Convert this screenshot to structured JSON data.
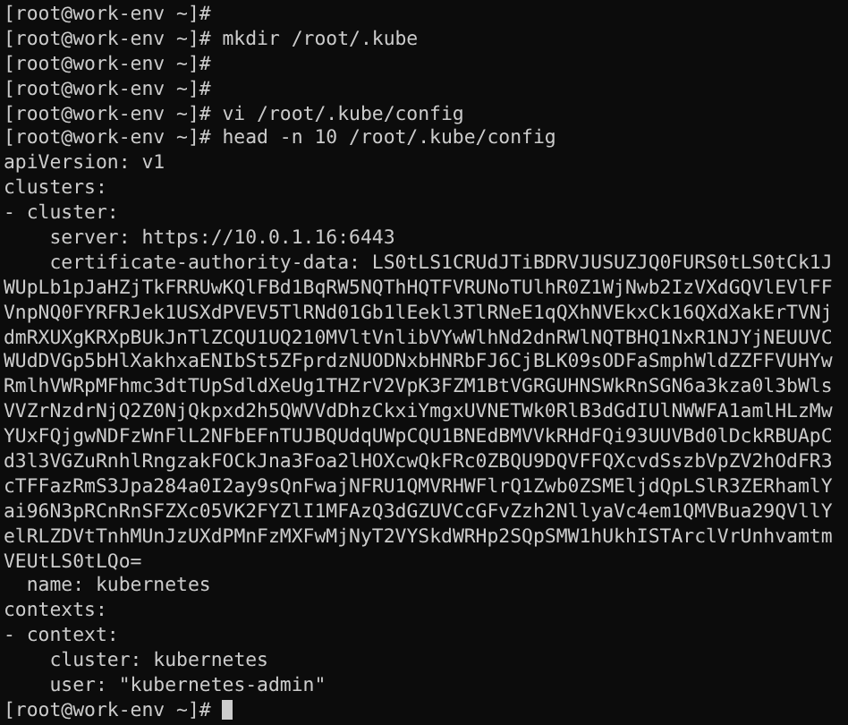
{
  "terminal": {
    "lines": [
      {
        "kind": "prompt",
        "prompt": "[root@work-env ~]#",
        "cursor": false
      },
      {
        "kind": "prompt",
        "prompt": "[root@work-env ~]#",
        "command": "mkdir /root/.kube",
        "cursor": false
      },
      {
        "kind": "prompt",
        "prompt": "[root@work-env ~]#",
        "cursor": false
      },
      {
        "kind": "prompt",
        "prompt": "[root@work-env ~]#",
        "cursor": false
      },
      {
        "kind": "prompt",
        "prompt": "[root@work-env ~]#",
        "command": "vi /root/.kube/config",
        "cursor": false
      },
      {
        "kind": "prompt",
        "prompt": "[root@work-env ~]#",
        "command": "head -n 10 /root/.kube/config",
        "cursor": false
      },
      {
        "kind": "output",
        "text": "apiVersion: v1"
      },
      {
        "kind": "output",
        "text": "clusters:"
      },
      {
        "kind": "output",
        "text": "- cluster:"
      },
      {
        "kind": "output",
        "text": "    server: https://10.0.1.16:6443"
      },
      {
        "kind": "output",
        "text": "    certificate-authority-data: LS0tLS1CRUdJTiBDRVJUSUZJQ0FURS0tLS0tCk1J"
      },
      {
        "kind": "output",
        "text": "WUpLb1pJaHZjTkFRRUwKQlFBd1BqRW5NQThHQTFVRUNoTUlhR0Z1WjNwb2IzVXdGQVlEVlFF"
      },
      {
        "kind": "output",
        "text": "VnpNQ0FYRFRJek1USXdPVEV5TlRNd01Gb1lEekl3TlRNeE1qQXhNVEkxCk16QXdXakErTVNj"
      },
      {
        "kind": "output",
        "text": "dmRXUXgKRXpBUkJnTlZCQU1UQ210MVltVnlibVYwWlhNd2dnRWlNQTBHQ1NxR1NJYjNEUUVC"
      },
      {
        "kind": "output",
        "text": "WUdDVGp5bHlXakhxaENIbSt5ZFprdzNUODNxbHNRbFJ6CjBLK09sODFaSmphWldZZFFVUHYw"
      },
      {
        "kind": "output",
        "text": "RmlhVWRpMFhmc3dtTUpSdldXeUg1THZrV2VpK3FZM1BtVGRGUHNSWkRnSGN6a3kza0l3bWls"
      },
      {
        "kind": "output",
        "text": "VVZrNzdrNjQ2Z0NjQkpxd2h5QWVVdDhzCkxiYmgxUVNETWk0RlB3dGdIUlNWWFA1amlHLzMw"
      },
      {
        "kind": "output",
        "text": "YUxFQjgwNDFzWnFlL2NFbEFnTUJBQUdqUWpCQU1BNEdBMVVkRHdFQi93UUVBd0lDckRBUApC"
      },
      {
        "kind": "output",
        "text": "d3l3VGZuRnhlRngzakFOCkJna3Foa2lHOXcwQkFRc0ZBQU9DQVFFQXcvdSszbVpZV2hOdFR3"
      },
      {
        "kind": "output",
        "text": "cTFFazRmS3Jpa284a0I2ay9sQnFwajNFRU1QMVRHWFlrQ1Zwb0ZSMEljdQpLSlR3ZERhamlY"
      },
      {
        "kind": "output",
        "text": "ai96N3pRCnRnSFZXc05VK2FYZlI1MFAzQ3dGZUVCcGFvZzh2NllyaVc4em1QMVBua29QVllY"
      },
      {
        "kind": "output",
        "text": "elRLZDVtTnhMUnJzUXdPMnFzMXFwMjNyT2VYSkdWRHp2SQpSMW1hUkhISTArclVrUnhvamtm"
      },
      {
        "kind": "output",
        "text": "VEUtLS0tLQo="
      },
      {
        "kind": "output",
        "text": "  name: kubernetes"
      },
      {
        "kind": "output",
        "text": "contexts:"
      },
      {
        "kind": "output",
        "text": "- context:"
      },
      {
        "kind": "output",
        "text": "    cluster: kubernetes"
      },
      {
        "kind": "output",
        "text": "    user: \"kubernetes-admin\""
      },
      {
        "kind": "prompt",
        "prompt": "[root@work-env ~]#",
        "cursor": true
      }
    ]
  }
}
